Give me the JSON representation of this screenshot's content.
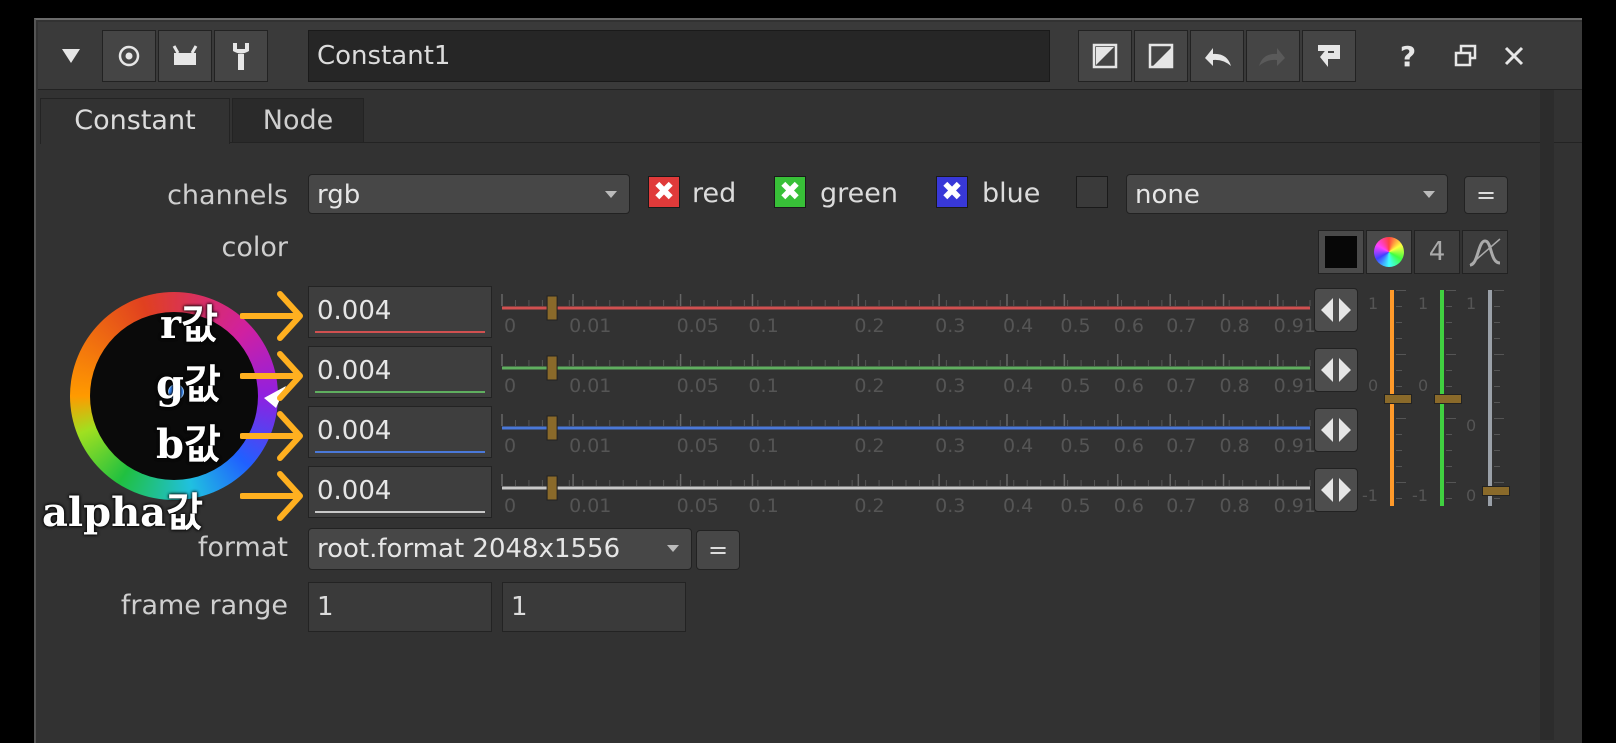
{
  "titlebar": {
    "node_name": "Constant1",
    "icons_left": [
      "collapse-triangle-icon",
      "viewer-circle-icon",
      "cut-icon",
      "wrench-icon"
    ],
    "icons_right": [
      "input-a-icon",
      "input-b-icon",
      "undo-icon",
      "redo-icon",
      "revert-icon",
      "help-icon",
      "float-window-icon",
      "close-icon"
    ],
    "help": "?"
  },
  "tabs": [
    {
      "label": "Constant",
      "active": true
    },
    {
      "label": "Node",
      "active": false
    }
  ],
  "knobs": {
    "channels_label": "channels",
    "channels_value": "rgb",
    "red_label": "red",
    "green_label": "green",
    "blue_label": "blue",
    "extra_channel_value": "none",
    "link_symbol": "=",
    "color_label": "color",
    "color_count": "4",
    "format_label": "format",
    "format_value": "root.format 2048x1556",
    "frame_range_label": "frame range",
    "frame_start": "1",
    "frame_end": "1"
  },
  "color_rows": [
    {
      "channel": "r",
      "value": "0.004",
      "line_color": "#d05050"
    },
    {
      "channel": "g",
      "value": "0.004",
      "line_color": "#5fae5f"
    },
    {
      "channel": "b",
      "value": "0.004",
      "line_color": "#4a78d8"
    },
    {
      "channel": "a",
      "value": "0.004",
      "line_color": "#c8c8c8"
    }
  ],
  "slider_ticks": [
    "0",
    "0.01",
    "0.05",
    "0.1",
    "0.2",
    "0.3",
    "0.4",
    "0.5",
    "0.6",
    "0.7",
    "0.8",
    "0.91"
  ],
  "side_sliders": {
    "tick_top": "1",
    "tick_mid": "0",
    "tick_low": "-1",
    "colors": [
      "#ff9a2a",
      "#40d040",
      "#9aa0a8"
    ]
  },
  "annotations": {
    "r": "r값",
    "g": "g값",
    "b": "b값",
    "alpha": "alpha값",
    "arrow_color": "#ffb020"
  },
  "colors": {
    "panel": "#323232",
    "red_check": "#e03a3a",
    "green_check": "#38c038",
    "blue_check": "#3838d8"
  }
}
